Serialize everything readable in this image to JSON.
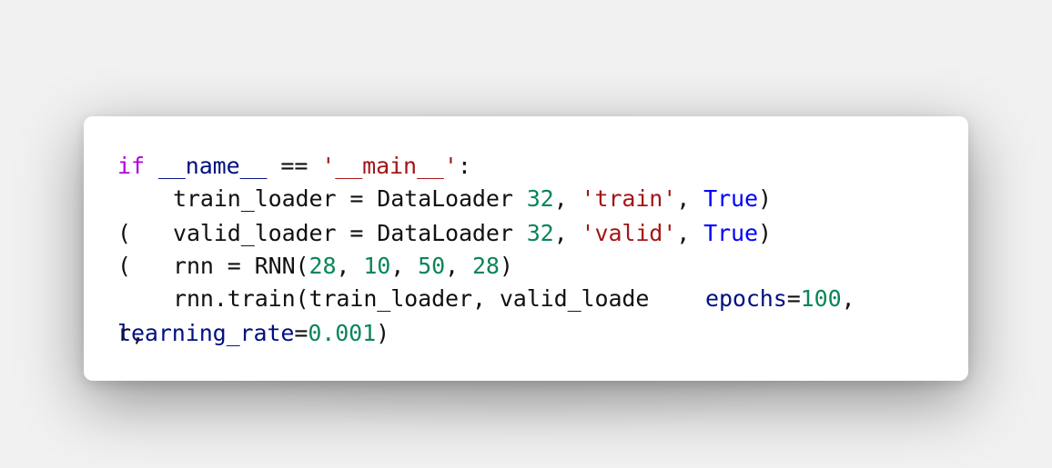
{
  "colors": {
    "background": "#f1f1f1",
    "card": "#ffffff",
    "keyword": "#af00db",
    "constant": "#0000ff",
    "identifier": "#001080",
    "string": "#a31515",
    "number": "#098658",
    "text": "#111111"
  },
  "code": {
    "line1": {
      "kw_if": "if",
      "name": "__name__",
      "op": " == ",
      "main_str": "'__main__'",
      "colon": ":"
    },
    "line2": {
      "prefix": "train_loader = DataLoader ",
      "num": "32",
      "comma1": ", ",
      "str": "'train'",
      "comma2": ", ",
      "kw_true": "True",
      "close": ")"
    },
    "line3": {
      "paren": "(",
      "prefix": "valid_loader = DataLoader ",
      "num": "32",
      "comma1": ", ",
      "str": "'valid'",
      "comma2": ", ",
      "kw_true": "True",
      "close": ")"
    },
    "line4": {
      "paren": "(",
      "prefix": "rnn = RNN(",
      "n1": "28",
      "c1": ", ",
      "n2": "10",
      "c2": ", ",
      "n3": "50",
      "c3": ", ",
      "n4": "28",
      "close": ")"
    },
    "line5": {
      "prefix": "rnn.train(train_loader, valid_loade",
      "param": "epochs",
      "eq": "=",
      "num": "100",
      "comma": ","
    },
    "line6": {
      "overlap": "r,",
      "param": "learning_rate",
      "eq": "=",
      "num": "0.001",
      "close": ")"
    }
  }
}
